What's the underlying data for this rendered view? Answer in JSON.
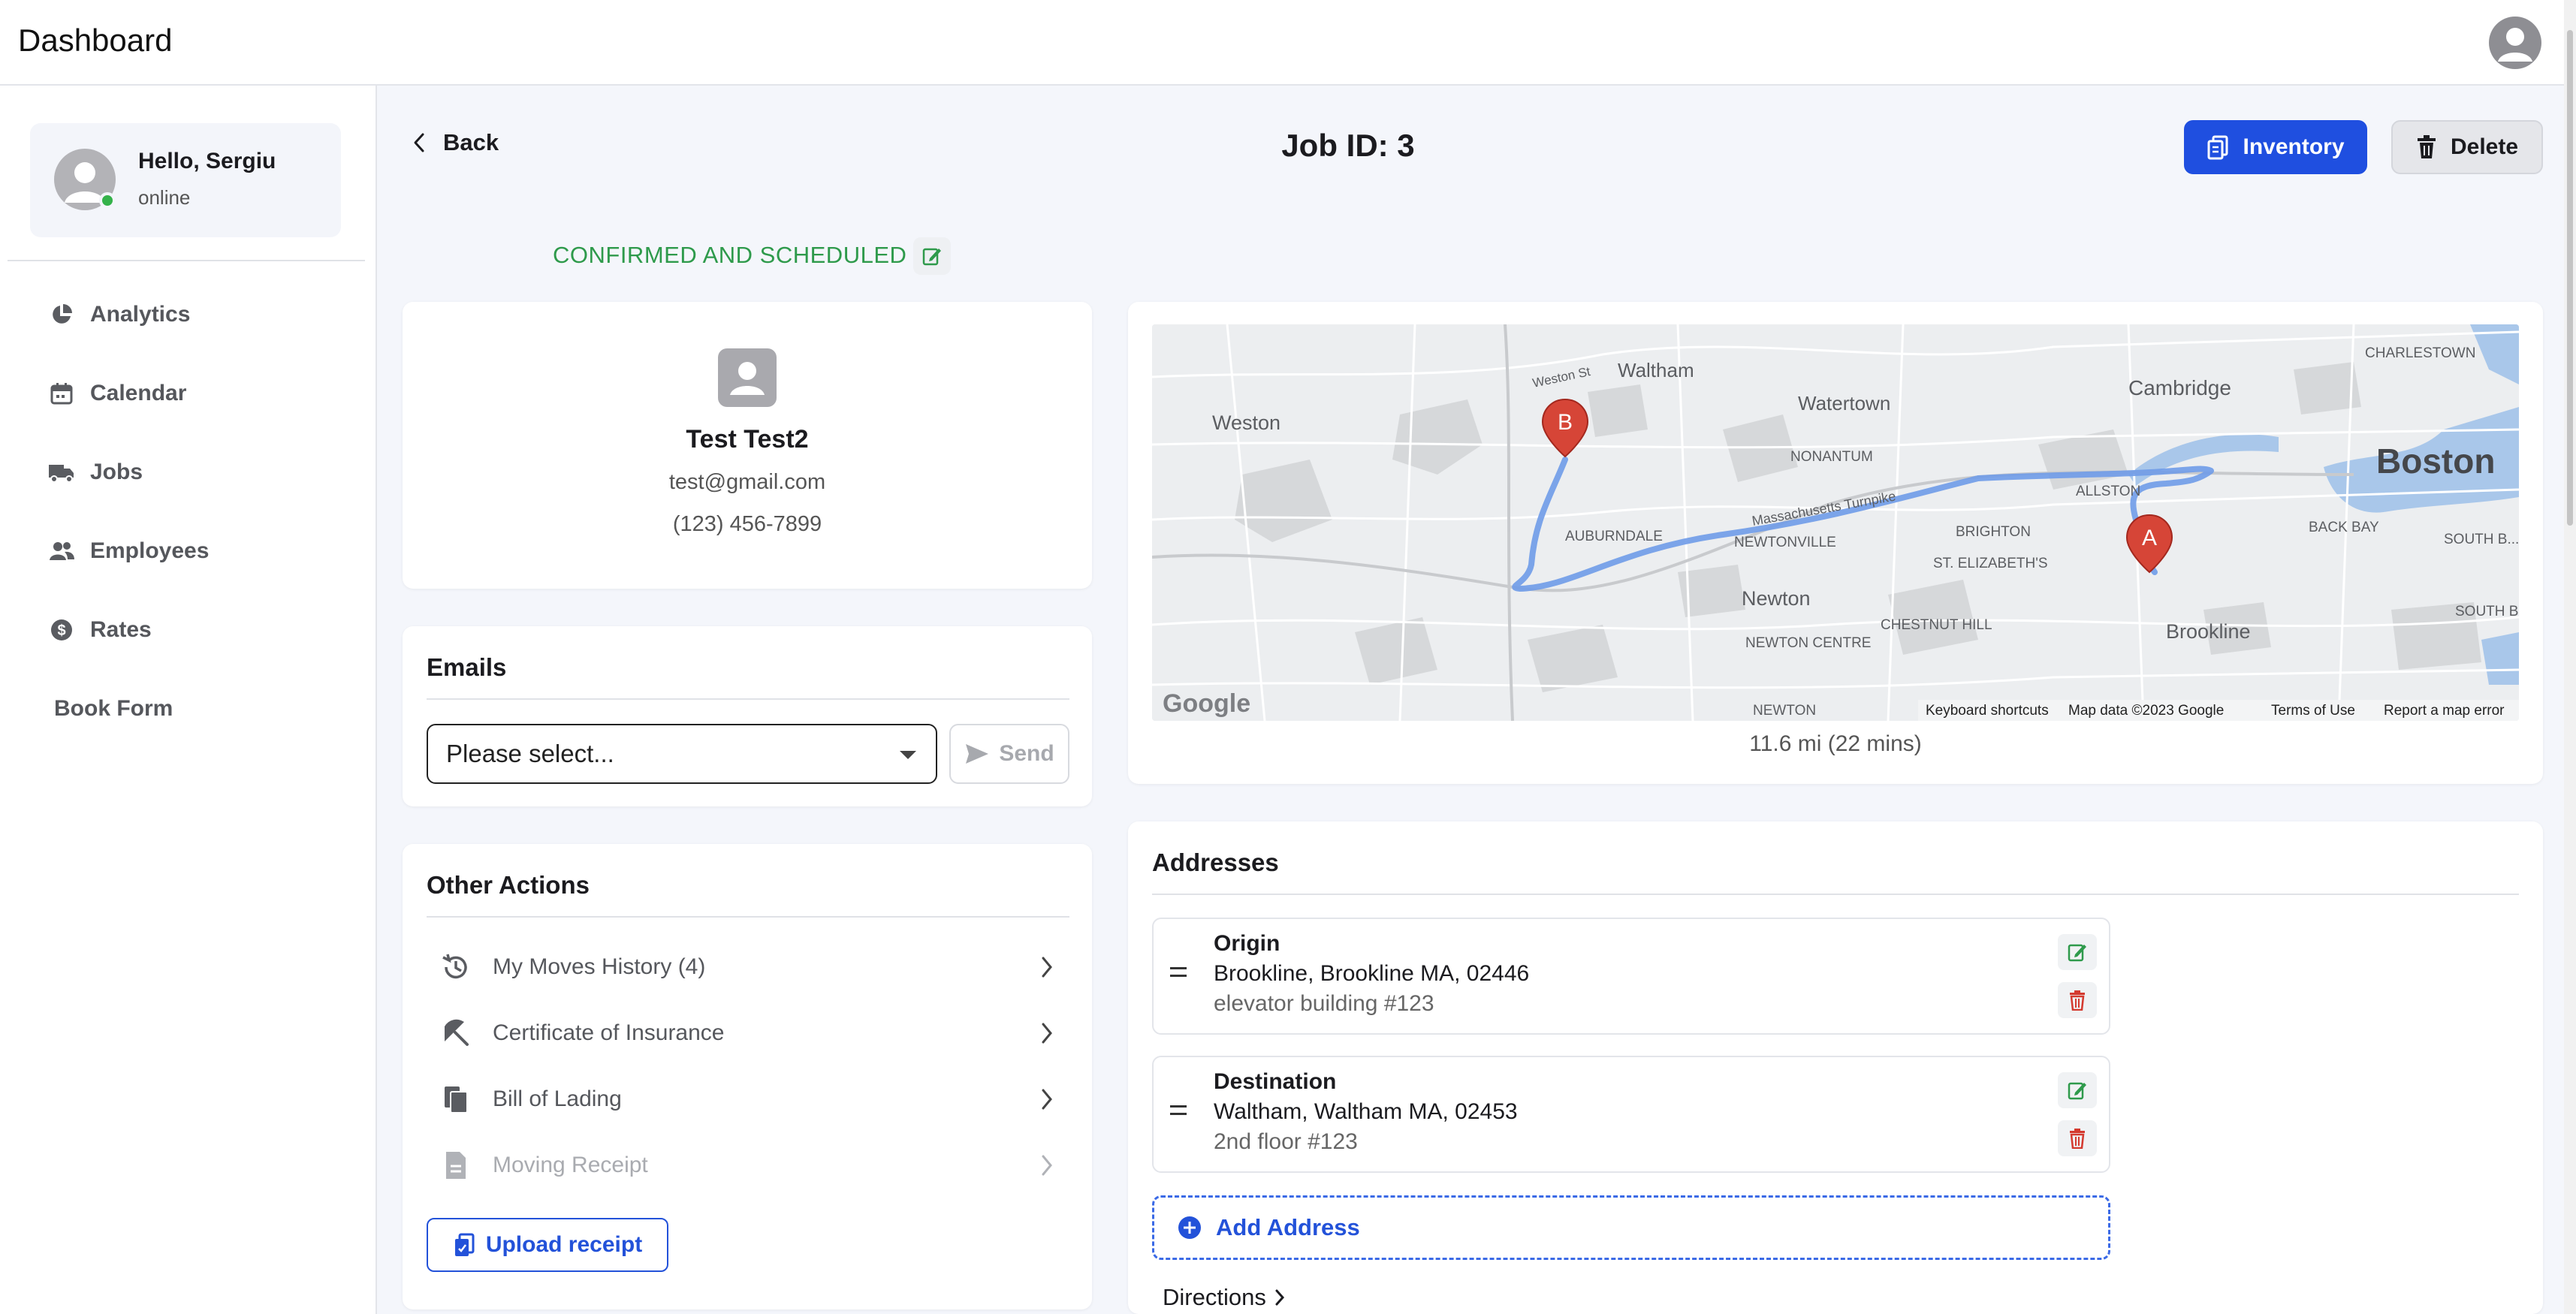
{
  "header": {
    "title": "Dashboard"
  },
  "sidebar": {
    "user": {
      "greeting": "Hello, Sergiu",
      "status": "online"
    },
    "items": [
      {
        "label": "Analytics",
        "icon": "pie-chart-icon"
      },
      {
        "label": "Calendar",
        "icon": "calendar-icon"
      },
      {
        "label": "Jobs",
        "icon": "truck-icon"
      },
      {
        "label": "Employees",
        "icon": "users-icon"
      },
      {
        "label": "Rates",
        "icon": "dollar-icon"
      },
      {
        "label": "Book Form",
        "icon": ""
      }
    ]
  },
  "page": {
    "back_label": "Back",
    "title": "Job ID: 3",
    "inventory_label": "Inventory",
    "delete_label": "Delete",
    "status": "CONFIRMED AND SCHEDULED",
    "status_color": "#2e9a4b",
    "accent_color": "#1f4fe0"
  },
  "contact": {
    "name": "Test Test2",
    "email": "test@gmail.com",
    "phone": "(123) 456-7899"
  },
  "emails": {
    "title": "Emails",
    "select_placeholder": "Please select...",
    "send_label": "Send"
  },
  "actions": {
    "title": "Other Actions",
    "items": [
      {
        "label": "My Moves History (4)",
        "icon": "history-icon",
        "enabled": true
      },
      {
        "label": "Certificate of Insurance",
        "icon": "umbrella-icon",
        "enabled": true
      },
      {
        "label": "Bill of Lading",
        "icon": "documents-icon",
        "enabled": true
      },
      {
        "label": "Moving Receipt",
        "icon": "receipt-icon",
        "enabled": false
      }
    ],
    "upload_label": "Upload receipt"
  },
  "map": {
    "labels": {
      "waltham": "Waltham",
      "watertown": "Watertown",
      "cambridge": "Cambridge",
      "charlestown": "CHARLESTOWN",
      "boston": "Boston",
      "weston": "Weston",
      "nonantum": "NONANTUM",
      "allston": "ALLSTON",
      "auburndale": "AUBURNDALE",
      "newtonville": "NEWTONVILLE",
      "brighton": "BRIGHTON",
      "back_bay": "BACK BAY",
      "st_elizabeths": "ST. ELIZABETH'S",
      "newton": "Newton",
      "chestnut_hill": "CHESTNUT HILL",
      "brookline": "Brookline",
      "newton_centre": "NEWTON CENTRE",
      "south_boston_waterfront": "SOUTH B... WATERF...",
      "south_boston": "SOUTH BOS",
      "weston_st": "Weston St",
      "turnpike": "Massachusetts Turnpike",
      "newton_bottom": "NEWTON"
    },
    "marker_a": "A",
    "marker_b": "B",
    "google": "Google",
    "footer": {
      "shortcuts": "Keyboard shortcuts",
      "map_data": "Map data ©2023 Google",
      "terms": "Terms of Use",
      "report": "Report a map error"
    },
    "distance": "11.6 mi (22 mins)"
  },
  "addresses": {
    "title": "Addresses",
    "items": [
      {
        "label": "Origin",
        "line": "Brookline, Brookline MA, 02446",
        "extra": "elevator building  #123"
      },
      {
        "label": "Destination",
        "line": "Waltham, Waltham MA, 02453",
        "extra": "2nd floor  #123"
      }
    ],
    "add_label": "Add Address",
    "directions_label": "Directions"
  }
}
